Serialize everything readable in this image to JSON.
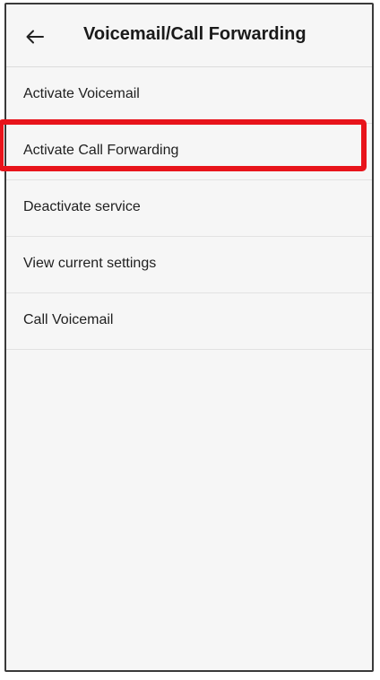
{
  "app_bar": {
    "title": "Voicemail/Call Forwarding",
    "back_icon": "arrow-left-icon"
  },
  "menu": {
    "items": [
      {
        "label": "Activate Voicemail"
      },
      {
        "label": "Activate Call Forwarding"
      },
      {
        "label": "Deactivate service"
      },
      {
        "label": "View current settings"
      },
      {
        "label": "Call Voicemail"
      }
    ]
  },
  "annotation": {
    "highlighted_item": "Activate Call Forwarding",
    "highlight_color": "#e8141b"
  }
}
